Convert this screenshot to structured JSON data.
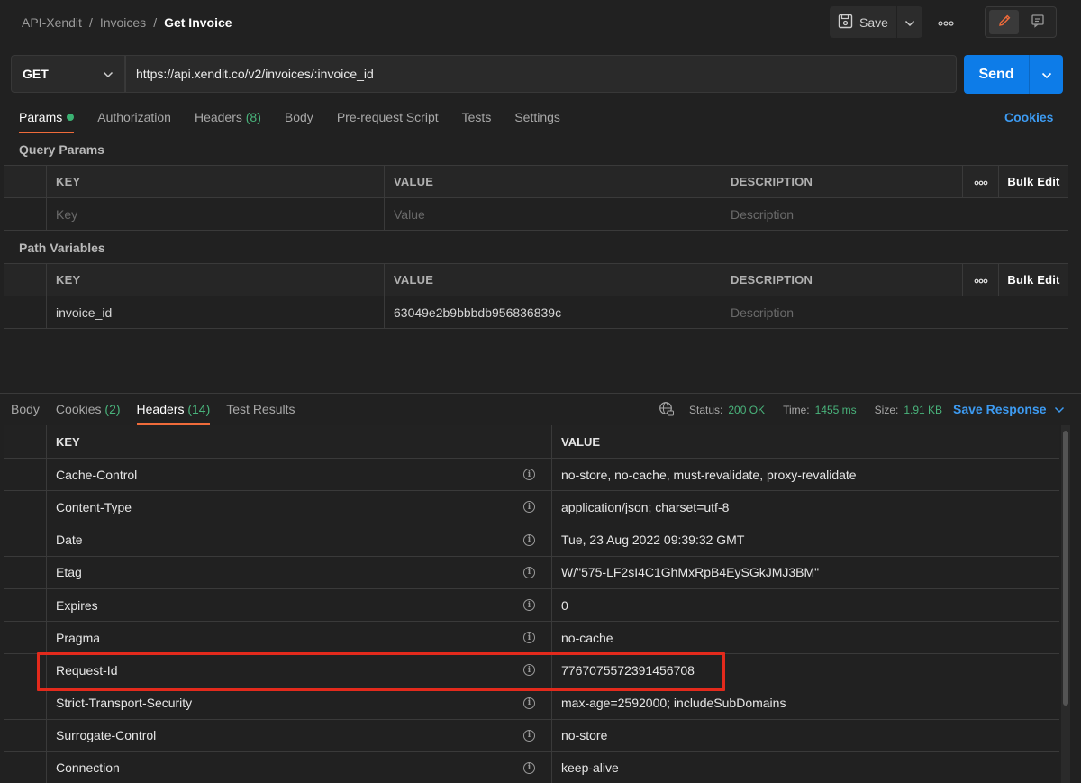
{
  "breadcrumb": {
    "items": [
      "API-Xendit",
      "Invoices"
    ],
    "current": "Get Invoice",
    "separator": "/"
  },
  "toolbar": {
    "save_label": "Save",
    "icons": [
      "save-icon",
      "chevron-down-icon",
      "more-icon",
      "edit-icon",
      "comment-icon"
    ]
  },
  "request": {
    "method": "GET",
    "url": "https://api.xendit.co/v2/invoices/:invoice_id",
    "send_label": "Send"
  },
  "request_tabs": {
    "params": "Params",
    "authorization": "Authorization",
    "headers": "Headers",
    "headers_count": "(8)",
    "body": "Body",
    "prerequest": "Pre-request Script",
    "tests": "Tests",
    "settings": "Settings",
    "cookies": "Cookies"
  },
  "query_params": {
    "title": "Query Params",
    "headers": {
      "key": "KEY",
      "value": "VALUE",
      "description": "DESCRIPTION",
      "bulk_edit": "Bulk Edit"
    },
    "placeholders": {
      "key": "Key",
      "value": "Value",
      "description": "Description"
    }
  },
  "path_variables": {
    "title": "Path Variables",
    "headers": {
      "key": "KEY",
      "value": "VALUE",
      "description": "DESCRIPTION",
      "bulk_edit": "Bulk Edit"
    },
    "rows": [
      {
        "key": "invoice_id",
        "value": "63049e2b9bbbdb956836839c",
        "description_placeholder": "Description"
      }
    ]
  },
  "response_tabs": {
    "body": "Body",
    "cookies": "Cookies",
    "cookies_count": "(2)",
    "headers": "Headers",
    "headers_count": "(14)",
    "test_results": "Test Results"
  },
  "response_meta": {
    "status_label": "Status:",
    "status_value": "200 OK",
    "time_label": "Time:",
    "time_value": "1455 ms",
    "size_label": "Size:",
    "size_value": "1.91 KB",
    "save_response": "Save Response"
  },
  "response_headers": {
    "columns": {
      "key": "KEY",
      "value": "VALUE"
    },
    "rows": [
      {
        "key": "Cache-Control",
        "value": "no-store, no-cache, must-revalidate, proxy-revalidate"
      },
      {
        "key": "Content-Type",
        "value": "application/json; charset=utf-8"
      },
      {
        "key": "Date",
        "value": "Tue, 23 Aug 2022 09:39:32 GMT"
      },
      {
        "key": "Etag",
        "value": "W/\"575-LF2sI4C1GhMxRpB4EySGkJMJ3BM\""
      },
      {
        "key": "Expires",
        "value": "0"
      },
      {
        "key": "Pragma",
        "value": "no-cache"
      },
      {
        "key": "Request-Id",
        "value": "7767075572391456708"
      },
      {
        "key": "Strict-Transport-Security",
        "value": "max-age=2592000; includeSubDomains"
      },
      {
        "key": "Surrogate-Control",
        "value": "no-store"
      },
      {
        "key": "Connection",
        "value": "keep-alive"
      }
    ]
  },
  "colors": {
    "background": "#212121",
    "accent_tab": "#ef6b3a",
    "send_button": "#0d7ce8",
    "link": "#3d9bf2",
    "success": "#49b37b",
    "highlight_box": "#e32a1c"
  }
}
